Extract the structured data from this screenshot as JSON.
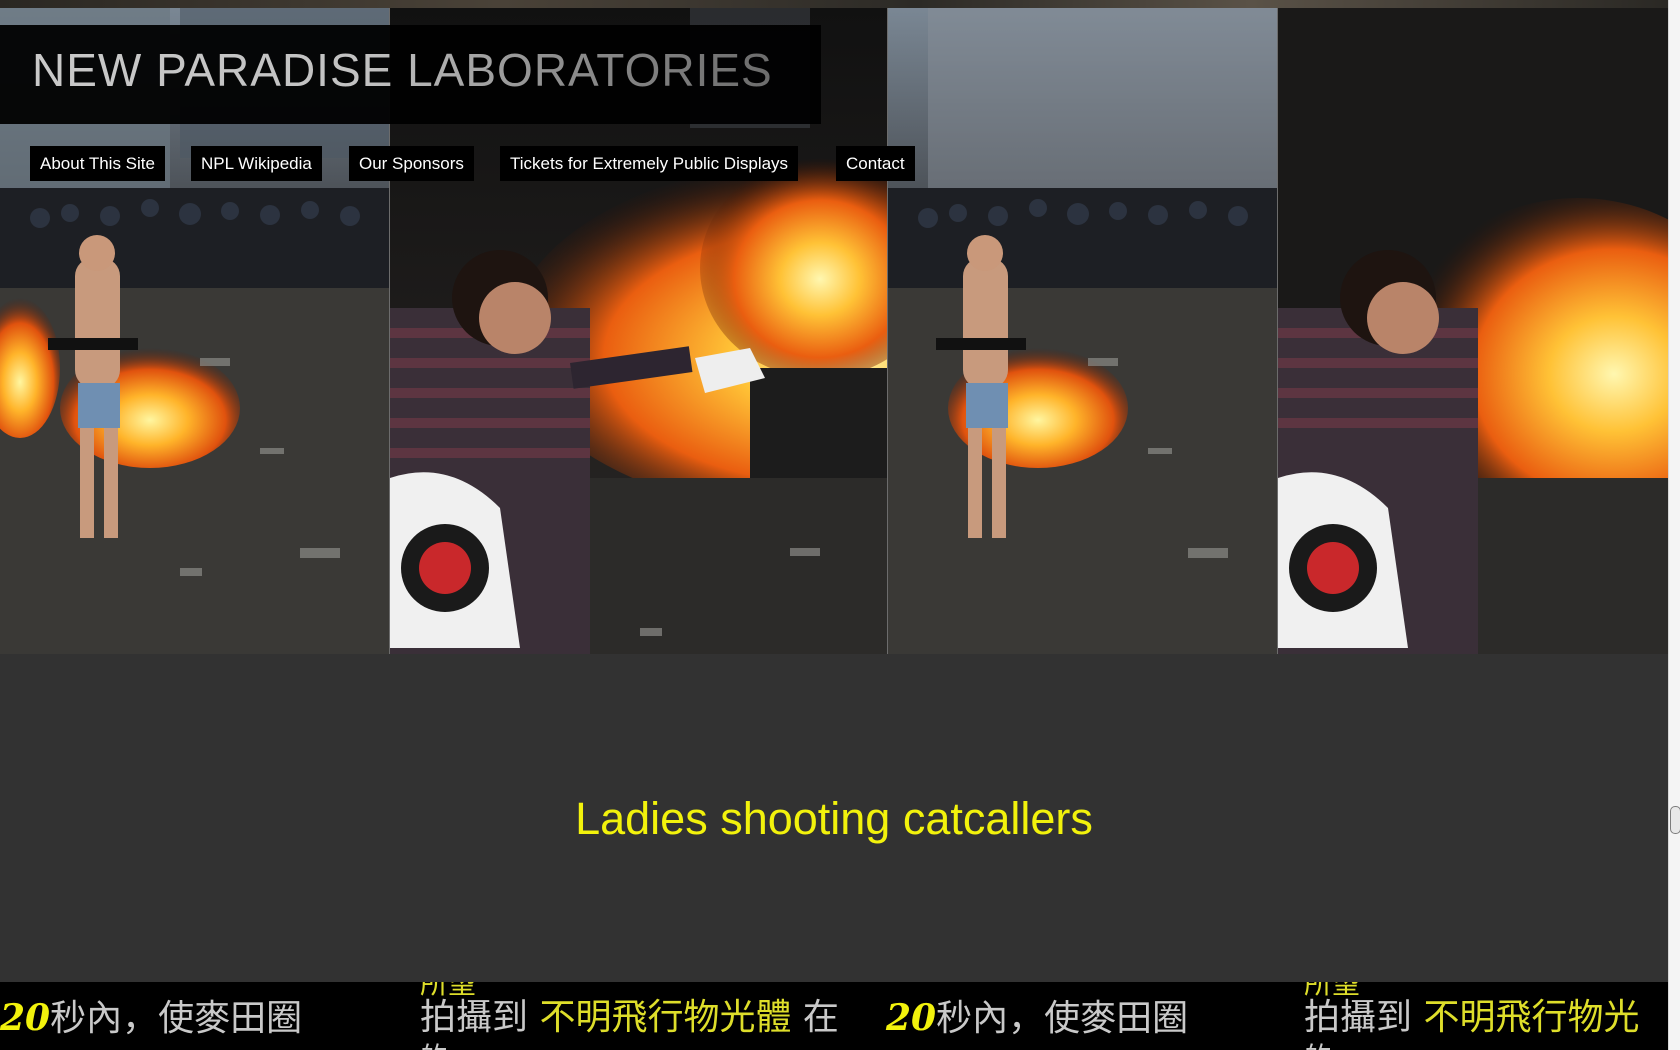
{
  "site": {
    "title": "NEW PARADISE LABORATORIES"
  },
  "nav": {
    "items": [
      {
        "label": "About This Site"
      },
      {
        "label": "NPL Wikipedia"
      },
      {
        "label": "Our Sponsors"
      },
      {
        "label": "Tickets for Extremely Public Displays"
      },
      {
        "label": "Contact"
      }
    ]
  },
  "hero": {
    "caption": "Ladies shooting catcallers",
    "image_tiles": [
      "riot-crowd-photo",
      "burning-car-photo",
      "riot-crowd-photo",
      "burning-car-photo"
    ]
  },
  "marquee": {
    "segments": [
      {
        "num": "20",
        "text": "秒內，使麥田圈"
      },
      {
        "top_fragment": "所望",
        "text_a": "拍攝到 ",
        "highlight": "不明飛行物光體",
        "text_b": " 在"
      },
      {
        "num": "20",
        "text": "秒內，使麥田圈"
      },
      {
        "top_fragment": "所望",
        "text_a": "拍攝到 ",
        "highlight": "不明飛行物光"
      }
    ],
    "fragment_bottom": "的"
  },
  "colors": {
    "caption": "#f2f20c",
    "caption_band": "#323232",
    "nav_bg": "#000000",
    "nav_text": "#ffffff"
  }
}
